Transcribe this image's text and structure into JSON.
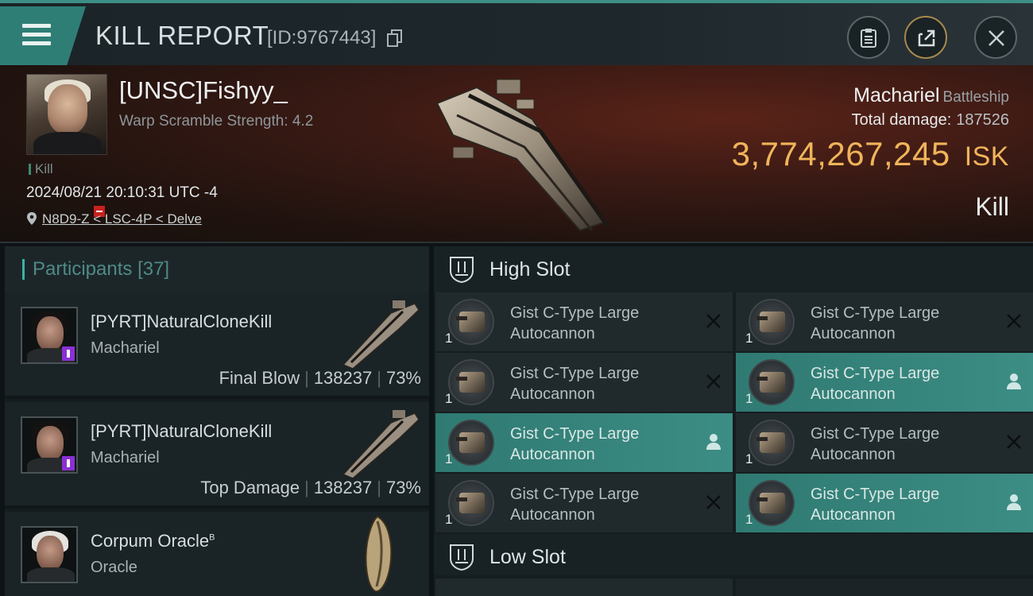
{
  "header": {
    "title": "KILL REPORT",
    "report_id": "[ID:9767443]"
  },
  "victim": {
    "name": "[UNSC]Fishyy_",
    "warp_scramble": "Warp Scramble Strength: 4.2",
    "tag": "Kill",
    "timestamp": "2024/08/21 20:10:31 UTC -4",
    "location": "N8D9-Z < LSC-4P < Delve",
    "ship_name": "Machariel",
    "ship_class": "Battleship",
    "total_damage_label": "Total damage:",
    "total_damage": "187526",
    "isk_value": "3,774,267,245",
    "isk_unit": "ISK",
    "outcome": "Kill"
  },
  "participants": {
    "label": "Participants",
    "count": "[37]",
    "items": [
      {
        "name": "[PYRT]NaturalCloneKill",
        "ship": "Machariel",
        "role": "Final Blow",
        "damage": "138237",
        "percent": "73%"
      },
      {
        "name": "[PYRT]NaturalCloneKill",
        "ship": "Machariel",
        "role": "Top Damage",
        "damage": "138237",
        "percent": "73%"
      },
      {
        "name": "Corpum Oracle",
        "superscript": "B",
        "ship": "Oracle"
      }
    ]
  },
  "fitting": {
    "high_slot_label": "High Slot",
    "low_slot_label": "Low Slot",
    "modules": [
      {
        "name_line1": "Gist C-Type Large",
        "name_line2": "Autocannon",
        "qty": "1",
        "state": "destroyed"
      },
      {
        "name_line1": "Gist C-Type Large",
        "name_line2": "Autocannon",
        "qty": "1",
        "state": "destroyed"
      },
      {
        "name_line1": "Gist C-Type Large",
        "name_line2": "Autocannon",
        "qty": "1",
        "state": "destroyed"
      },
      {
        "name_line1": "Gist C-Type Large",
        "name_line2": "Autocannon",
        "qty": "1",
        "state": "dropped"
      },
      {
        "name_line1": "Gist C-Type Large",
        "name_line2": "Autocannon",
        "qty": "1",
        "state": "dropped"
      },
      {
        "name_line1": "Gist C-Type Large",
        "name_line2": "Autocannon",
        "qty": "1",
        "state": "destroyed"
      },
      {
        "name_line1": "Gist C-Type Large",
        "name_line2": "Autocannon",
        "qty": "1",
        "state": "destroyed"
      },
      {
        "name_line1": "Gist C-Type Large",
        "name_line2": "Autocannon",
        "qty": "1",
        "state": "dropped"
      }
    ]
  },
  "colors": {
    "accent": "#3c8f86",
    "isk": "#f0b45a",
    "highlight": "#3c8d84"
  }
}
